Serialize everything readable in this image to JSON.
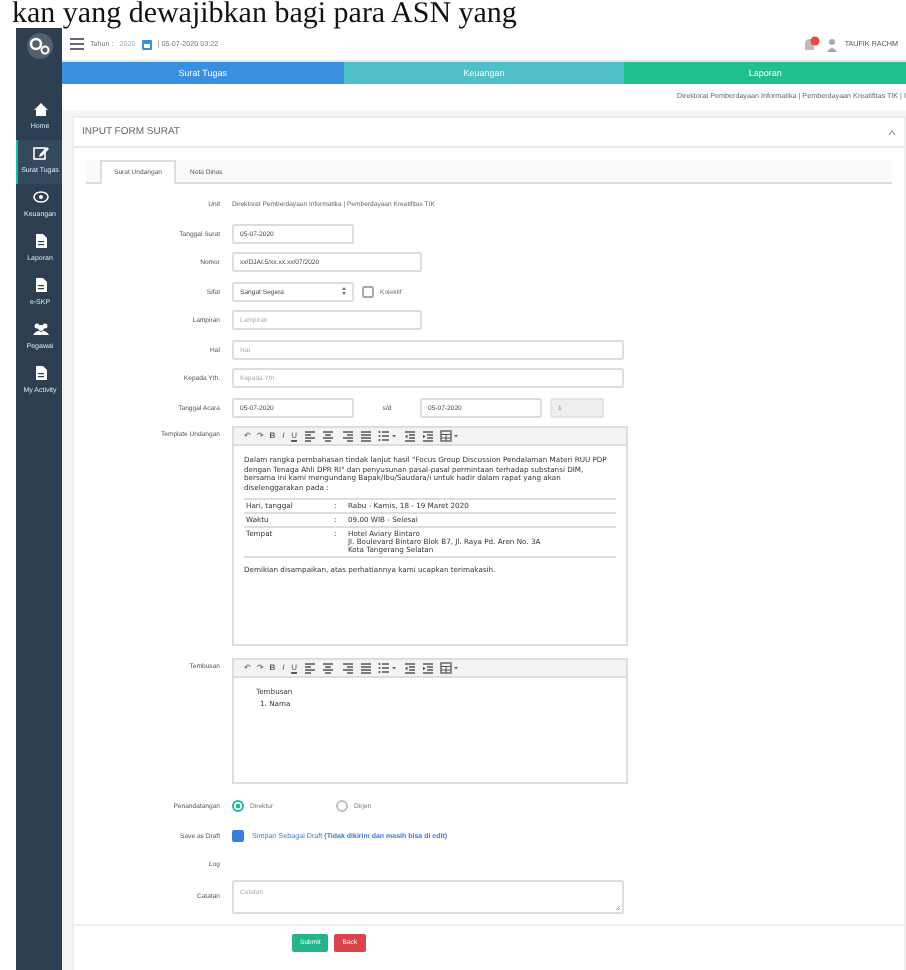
{
  "document_text": "kan yang dewajibkan bagi para ASN yang",
  "header": {
    "year_label": "Tahun :",
    "year": "2020",
    "datetime": "| 05-07-2020 03:22",
    "user_name": "TAUFIK RACHM"
  },
  "sidebar": {
    "items": [
      {
        "label": "Home",
        "kind": "home",
        "selected": false
      },
      {
        "label": "Surat Tugas",
        "kind": "edit",
        "selected": true
      },
      {
        "label": "Keuangan",
        "kind": "money",
        "selected": false
      },
      {
        "label": "Laporan",
        "kind": "document",
        "selected": false
      },
      {
        "label": "e-SKP",
        "kind": "document",
        "selected": false
      },
      {
        "label": "Pegawai",
        "kind": "people",
        "selected": false
      },
      {
        "label": "My Activity",
        "kind": "document",
        "selected": false
      }
    ]
  },
  "nav_tabs": [
    {
      "label": "Surat Tugas",
      "color": "#3b8fe0"
    },
    {
      "label": "Keuangan",
      "color": "#4fc0c8"
    },
    {
      "label": "Laporan",
      "color": "#20bf8e"
    }
  ],
  "breadcrumb": "Direktorat Pemberdayaan Informatika | Pemberdayaan Kreatifitas TIK | I",
  "panel_title": "INPUT FORM SURAT",
  "form_tabs": [
    {
      "label": "Surat Undangan",
      "selected": true
    },
    {
      "label": "Nota Dinas",
      "selected": false
    }
  ],
  "form": [
    {
      "kind": "static",
      "label": "Unit",
      "text": "Direktorat Pemberdayaan Informatika | Pemberdayaan Kreatifitas TIK"
    },
    {
      "kind": "short_input",
      "label": "Tanggal Surat",
      "value": "05-07-2020"
    },
    {
      "kind": "input",
      "label": "Nomor",
      "value": "xx/DJAI.5/xx.xx.xx/07/2020"
    },
    {
      "kind": "select",
      "label": "Sifat",
      "value": "Sangat Segera",
      "checkbox": {
        "label": "Kolektif",
        "checked": false
      }
    },
    {
      "kind": "input",
      "label": "Lampiran",
      "placeholder": "Lampiran"
    },
    {
      "kind": "long_input",
      "label": "Hal",
      "placeholder": "Hal"
    },
    {
      "kind": "long_input",
      "label": "Kepada Yth.",
      "placeholder": "Kepada Yth."
    },
    {
      "kind": "range",
      "label": "Tanggal Acara",
      "from": "05-07-2020",
      "separator": "s/d",
      "to": "05-07-2020",
      "days": "1"
    },
    {
      "kind": "template_editor",
      "label": "Template Undangan",
      "toolbar": [
        {
          "kind": "undo",
          "text": "↶"
        },
        {
          "kind": "redo",
          "text": "↷"
        },
        {
          "kind": "bold",
          "text": "B"
        },
        {
          "kind": "italic",
          "text": "I"
        },
        {
          "kind": "underline",
          "text": "U"
        },
        {
          "kind": "align-left"
        },
        {
          "kind": "align-center"
        },
        {
          "kind": "align-right"
        },
        {
          "kind": "justify"
        },
        {
          "kind": "list"
        },
        {
          "kind": "outdent"
        },
        {
          "kind": "indent"
        },
        {
          "kind": "table"
        }
      ],
      "intro": "Dalam rangka pembahasan tindak lanjut hasil \"Focus Group Discussion Pendalaman Materi RUU PDP dengan Tenaga Ahli DPR RI\" dan penyusunan pasal-pasal permintaan terhadap substansi DIM, bersama ini kami mengundang Bapak/Ibu/Saudara/i untuk hadir dalam rapat yang akan diselenggarakan pada :",
      "details": [
        {
          "name": "Hari, tanggal",
          "sep": ":",
          "lines": [
            "Rabu - Kamis, 18 - 19 Maret 2020"
          ]
        },
        {
          "name": "Waktu",
          "sep": ":",
          "lines": [
            "09.00 WIB - Selesai"
          ]
        },
        {
          "name": "Tempat",
          "sep": ":",
          "lines": [
            "Hotel Aviary Bintaro",
            "Jl. Boulevard Bintaro Blok B7, Jl. Raya Pd. Aren No. 3A",
            "Kota Tangerang Selatan"
          ]
        }
      ],
      "closing": "Demikian disampaikan, atas perhatiannya kami ucapkan terimakasih."
    },
    {
      "kind": "editor",
      "label": "Tembusan",
      "toolbar": [
        {
          "kind": "undo",
          "text": "↶"
        },
        {
          "kind": "redo",
          "text": "↷"
        },
        {
          "kind": "bold",
          "text": "B"
        },
        {
          "kind": "italic",
          "text": "I"
        },
        {
          "kind": "underline",
          "text": "U"
        },
        {
          "kind": "align-left"
        },
        {
          "kind": "align-center"
        },
        {
          "kind": "align-right"
        },
        {
          "kind": "justify"
        },
        {
          "kind": "list"
        },
        {
          "kind": "outdent"
        },
        {
          "kind": "indent"
        },
        {
          "kind": "table"
        }
      ],
      "lines": [
        "Tembusan",
        "1. Nama"
      ]
    },
    {
      "kind": "radio",
      "label": "Penandatangan",
      "options": [
        {
          "label": "Direktur",
          "selected": true
        },
        {
          "label": "Dirjen",
          "selected": false
        }
      ]
    },
    {
      "kind": "checkbox",
      "label": "Save as Draft",
      "checked": true,
      "text": "Simpan Sebagai Draft **(Tidak dikirim dan masih bisa di edit)**"
    },
    {
      "kind": "label_only",
      "label": "Log"
    },
    {
      "kind": "textarea",
      "label": "Catatan",
      "placeholder": "Catatan"
    }
  ],
  "buttons": [
    {
      "label": "Submit",
      "kind": "primary"
    },
    {
      "label": "Back",
      "kind": "danger"
    }
  ]
}
